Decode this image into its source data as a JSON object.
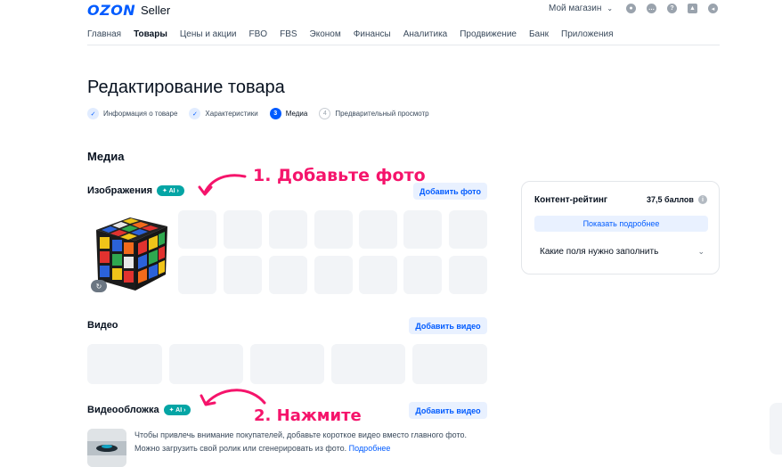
{
  "header": {
    "logo": "OZON",
    "logo_suffix": "Seller",
    "store_label": "Мой магазин",
    "icons": [
      "user-icon",
      "chat-icon",
      "help-icon",
      "education-icon",
      "notifications-icon"
    ]
  },
  "nav": {
    "items": [
      "Главная",
      "Товары",
      "Цены и акции",
      "FBO",
      "FBS",
      "Эконом",
      "Финансы",
      "Аналитика",
      "Продвижение",
      "Банк",
      "Приложения"
    ],
    "active": "Товары"
  },
  "page": {
    "title": "Редактирование товара"
  },
  "steps": [
    {
      "label": "Информация о товаре",
      "state": "done",
      "mark": "✓"
    },
    {
      "label": "Характеристики",
      "state": "done",
      "mark": "✓"
    },
    {
      "label": "Медиа",
      "state": "current",
      "mark": "3"
    },
    {
      "label": "Предварительный просмотр",
      "state": "todo",
      "mark": "4"
    }
  ],
  "media": {
    "heading": "Медиа",
    "images": {
      "label": "Изображения",
      "ai_badge": "AI",
      "add_button": "Добавить фото"
    },
    "video": {
      "label": "Видео",
      "add_button": "Добавить видео"
    },
    "cover": {
      "label": "Видеообложка",
      "ai_badge": "AI",
      "add_button": "Добавить видео",
      "description_line1": "Чтобы привлечь внимание покупателей, добавьте короткое видео вместо главного фото.",
      "description_line2": "Можно загрузить свой ролик или сгенерировать из фото.",
      "more_link": "Подробнее"
    }
  },
  "annotations": {
    "first": "1. Добавьте фото",
    "second": "2. Нажмите",
    "color": "#f5146b"
  },
  "rating_card": {
    "title": "Контент-рейтинг",
    "score": "37,5 баллов",
    "details_button": "Показать подробнее",
    "fields_dropdown": "Какие поля нужно заполнить"
  },
  "colors": {
    "accent": "#005bff",
    "ai_badge": "#04a5a5",
    "slot": "#f2f4f7"
  }
}
